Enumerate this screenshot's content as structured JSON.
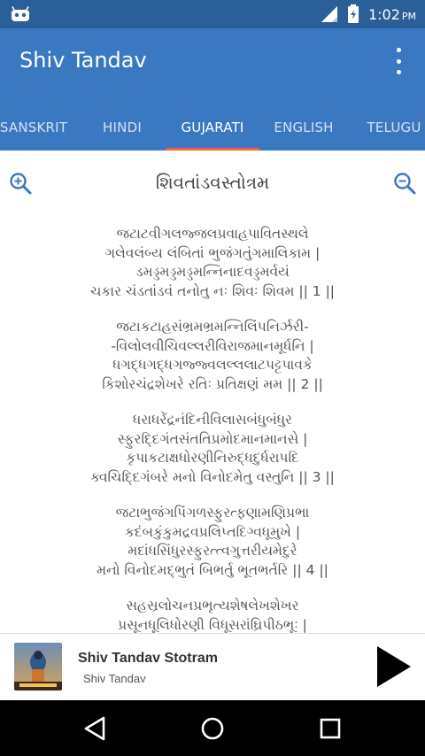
{
  "status_bar": {
    "time": "1:02",
    "ampm": "PM",
    "icons": [
      "android-debug-icon",
      "signal-icon",
      "battery-icon"
    ]
  },
  "app_bar": {
    "title": "Shiv Tandav",
    "menu_icon": "overflow-menu-icon"
  },
  "tabs": [
    {
      "label": "SANSKRIT",
      "active": false
    },
    {
      "label": "HINDI",
      "active": false
    },
    {
      "label": "GUJARATI",
      "active": true
    },
    {
      "label": "ENGLISH",
      "active": false
    },
    {
      "label": "TELUGU",
      "active": false
    }
  ],
  "content": {
    "title": "શિવતાંડવસ્તોત્રમ",
    "zoom_in_icon": "zoom-in-icon",
    "zoom_out_icon": "zoom-out-icon",
    "verses": [
      {
        "lines": [
          "જટાટવીગલજ્જલપ્રવાહપાવિતસ્થલે",
          "ગલેવલંબ્ય લંબિતાં ભુજંગતુંગમાલિકામ |",
          "ડમડ્ડમડ્ડમડ્ડમન્નિનાદવડ્ડમર્વયં",
          "ચકાર ચંડતાંડવં તનોતુ નઃ શિવઃ શિવમ || 1 ||"
        ]
      },
      {
        "lines": [
          "જટાકટાહસંભ્રમભ્રમન્નિલિંપનિર્ઝરી-",
          "-વિલોલવીચિવલ્લરીવિરાજમાનમૂર્ધનિ |",
          "ધગદ્ધગદ્ધગજ્જ્વલલ્લલાટપટ્ટપાવકે",
          "કિશોરચંદ્રશેખરે રતિઃ પ્રતિક્ષણં મમ || 2 ||"
        ]
      },
      {
        "lines": [
          "ધરાધરેંદ્રનંદિનીવિલાસબંધુબંધુર",
          "સ્ફુરદ્દિગંતસંતતિપ્રમોદમાનમાનસે |",
          "કૃપાકટાક્ષધોરણીનિરુદ્ધદુર્ધરાપદિ",
          "ક્વચિદ્દિગંબરે મનો વિનોદમેતુ વસ્તુનિ || 3 ||"
        ]
      },
      {
        "lines": [
          "જટાભુજંગપિંગળસ્ફુરત્ફણામણિપ્રભા",
          "કદંબકુંકુમદ્રવપ્રલિપ્તદિગ્વધૂમુખે |",
          "મદાંધસિંધુરસ્ફુરત્ત્વગુત્તરીયમેદુરે",
          "મનો વિનોદમદ્ભુતં બિભર્તુ ભૂતભર્તરિ || 4 ||"
        ]
      },
      {
        "lines": [
          "સહસ્રલોચનપ્રભૃત્યશેષલેખશેખર",
          "પ્રસૂનધૂલિધોરણી વિધૂસરાંઘ્રિપીઠભૂઃ |"
        ]
      }
    ]
  },
  "player": {
    "title": "Shiv Tandav Stotram",
    "subtitle": "Shiv Tandav",
    "play_icon": "play-icon"
  },
  "nav_bar": {
    "icons": [
      "back-icon",
      "home-icon",
      "recents-icon"
    ]
  },
  "colors": {
    "status_bar": "#2b5f97",
    "app_bar": "#3b78c2",
    "tab_indicator": "#ff5a36",
    "zoom_icon": "#3b78c2"
  }
}
